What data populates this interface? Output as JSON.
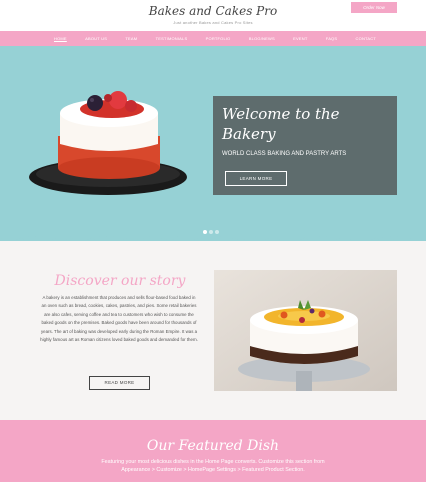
{
  "header": {
    "title": "Bakes and Cakes Pro",
    "tagline": "Just another Bakes and Cakes Pro Sites",
    "order_button": "Order Now"
  },
  "nav": {
    "items": [
      "HOME",
      "ABOUT US",
      "TEAM",
      "TESTIMONIALS",
      "PORTFOLIO",
      "BLOG/NEWS",
      "EVENT",
      "FAQS",
      "CONTACT"
    ],
    "active_index": 0
  },
  "hero": {
    "title": "Welcome to the Bakery",
    "subtitle": "WORLD CLASS BAKING AND PASTRY ARTS",
    "button": "LEARN MORE",
    "slides": 3,
    "active_slide": 0
  },
  "about": {
    "title": "Discover our story",
    "text": "A bakery is an establishment that produces and sells flour-based food baked in an oven such as bread, cookies, cakes, pastries, and pies. Some retail bakeries are also cafes, serving coffee and tea to customers who wish to consume the baked goods on the premises. Baked goods have been around for thousands of years. The art of baking was developed early during the Roman Empire. It was a highly famous art as Roman citizens loved baked goods and demanded for them.",
    "button": "READ MORE"
  },
  "featured": {
    "title": "Our Featured Dish",
    "text": "Featuring your most delicious dishes in the Home Page converts. Customize this section from Appearance > Customize > HomePage Settings > Featured Product Section."
  },
  "colors": {
    "brand_pink": "#f4a6c6",
    "hero_teal": "#96d1d5",
    "hero_box": "#5e6c6d",
    "about_bg": "#f6f4f3"
  }
}
